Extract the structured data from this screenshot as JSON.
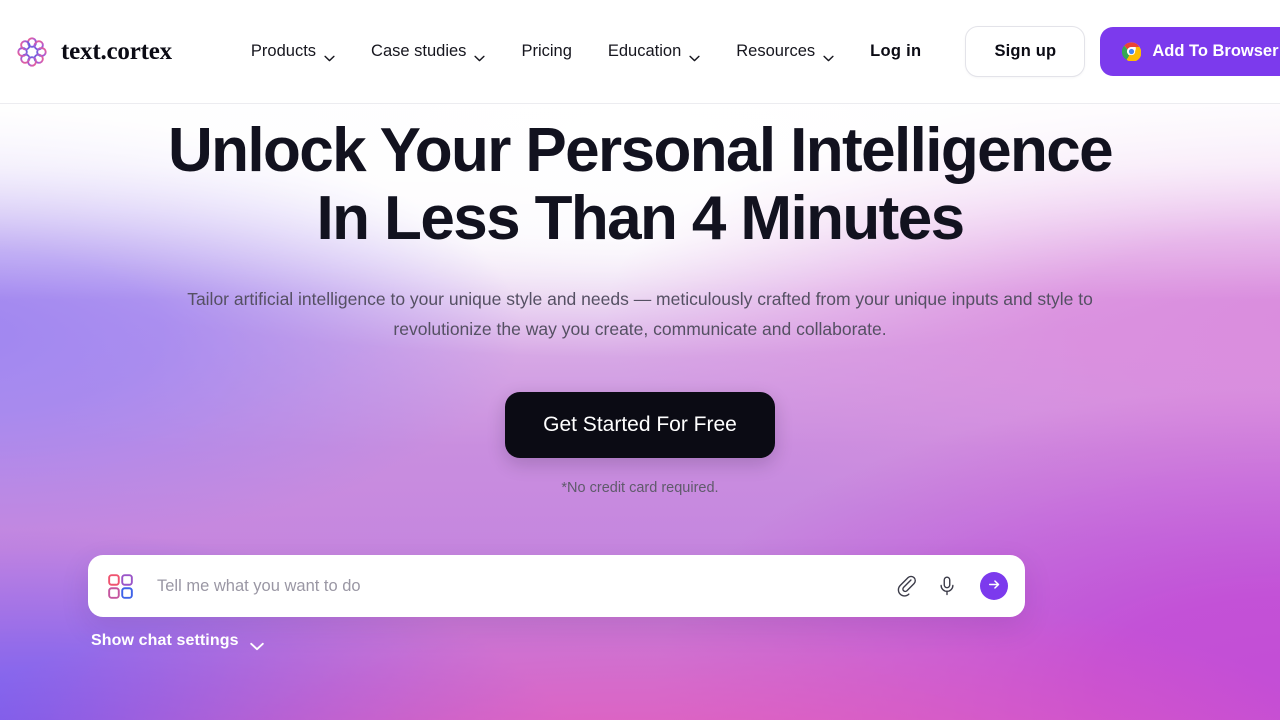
{
  "brand": {
    "name": "text.cortex",
    "logo_icon": "textcortex-petal-logo-icon"
  },
  "nav": {
    "items": [
      {
        "label": "Products",
        "has_menu": true,
        "icon": "chevron-down-icon"
      },
      {
        "label": "Case studies",
        "has_menu": true,
        "icon": "chevron-down-icon"
      },
      {
        "label": "Pricing",
        "has_menu": false,
        "icon": ""
      },
      {
        "label": "Education",
        "has_menu": true,
        "icon": "chevron-down-icon"
      },
      {
        "label": "Resources",
        "has_menu": true,
        "icon": "chevron-down-icon"
      }
    ],
    "login_label": "Log in",
    "signup_label": "Sign up",
    "add_to_browser_label": "Add To Browser",
    "add_to_browser_icon": "chrome-icon"
  },
  "hero": {
    "headline_line1": "Unlock Your Personal Intelligence",
    "headline_line2": "In Less Than 4 Minutes",
    "subheadline": "Tailor artificial intelligence to your unique style and needs — meticulously crafted from your unique inputs and style to revolutionize the way you create, communicate and collaborate.",
    "cta_label": "Get Started For Free",
    "cta_note": "*No credit card required."
  },
  "chat": {
    "grid_icon": "apps-grid-icon",
    "placeholder": "Tell me what you want to do",
    "value": "",
    "attach_icon": "paperclip-icon",
    "mic_icon": "microphone-icon",
    "send_icon": "arrow-right-icon",
    "settings_label": "Show chat settings",
    "settings_icon": "chevron-down-icon"
  },
  "colors": {
    "accent_purple": "#7c3aed",
    "cta_black": "#0b0b14",
    "heading": "#12121f",
    "body_text": "#555063",
    "bg_gradient_left": "#6f5df0",
    "bg_gradient_center": "#e85ab5",
    "bg_gradient_right": "#c14ed4",
    "bg_gradient_top": "#ffffff"
  }
}
